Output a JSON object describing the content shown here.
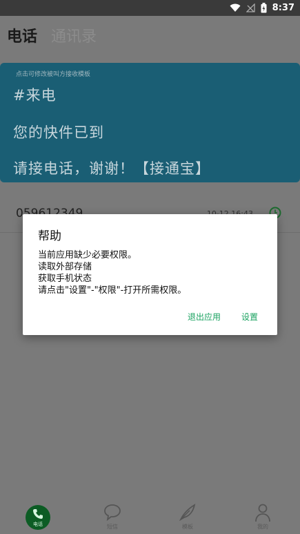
{
  "status_bar": {
    "time": "8:37",
    "icons": [
      "wifi-icon",
      "no-signal-icon",
      "battery-icon"
    ]
  },
  "tabs": {
    "active": "电话",
    "inactive": "通讯录"
  },
  "template": {
    "hint": "点击可修改被叫方接收模板",
    "line1": "#来电",
    "line2": "您的快件已到",
    "line3": "请接电话，谢谢！【接通宝】"
  },
  "call_log": {
    "number": "059612349",
    "time": "10-12 16:43",
    "status_icon": "clock-icon"
  },
  "dialog": {
    "title": "帮助",
    "lines": [
      "当前应用缺少必要权限。",
      "读取外部存储",
      "获取手机状态",
      "请点击\"设置\"-\"权限\"-打开所需权限。"
    ],
    "exit_label": "退出应用",
    "settings_label": "设置"
  },
  "bottom_nav": {
    "phone": "电话",
    "sms": "短信",
    "template": "模板",
    "mine": "我的"
  },
  "colors": {
    "accent_green": "#1aa260",
    "card_bg": "#1a5e74",
    "overlay_bg": "#7a7a7a"
  }
}
